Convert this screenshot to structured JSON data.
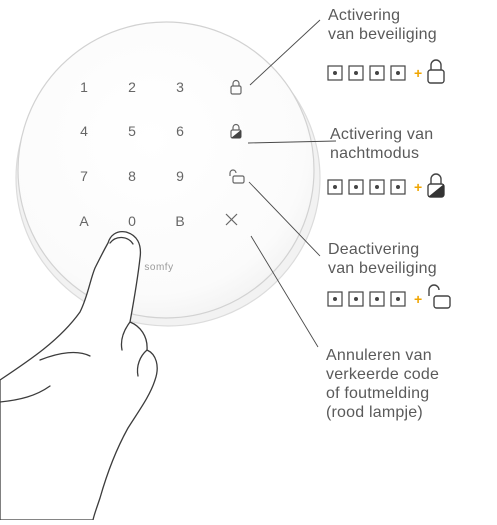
{
  "keypad": {
    "keys": [
      "1",
      "2",
      "3",
      "4",
      "5",
      "6",
      "7",
      "8",
      "9",
      "A",
      "0",
      "B"
    ],
    "icons": [
      "padlock-closed-icon",
      "padlock-half-icon",
      "padlock-open-icon",
      "cross-icon"
    ],
    "brand": "somfy"
  },
  "callouts": [
    {
      "lines": [
        "Activering",
        "van beveiliging"
      ],
      "icon": "padlock-closed-icon"
    },
    {
      "lines": [
        "Activering van",
        "nachtmodus"
      ],
      "icon": "padlock-half-icon"
    },
    {
      "lines": [
        "Deactivering",
        "van beveiliging"
      ],
      "icon": "padlock-open-icon"
    },
    {
      "lines": [
        "Annuleren van",
        "verkeerde code",
        "of foutmelding",
        "(rood lampje)"
      ]
    }
  ],
  "sequence": {
    "plus": "+",
    "code_boxes": 4
  },
  "colors": {
    "plus": "#f0a500",
    "line": "#4a4a4a",
    "device_edge": "#d6d6d6",
    "key_text": "#666666"
  }
}
